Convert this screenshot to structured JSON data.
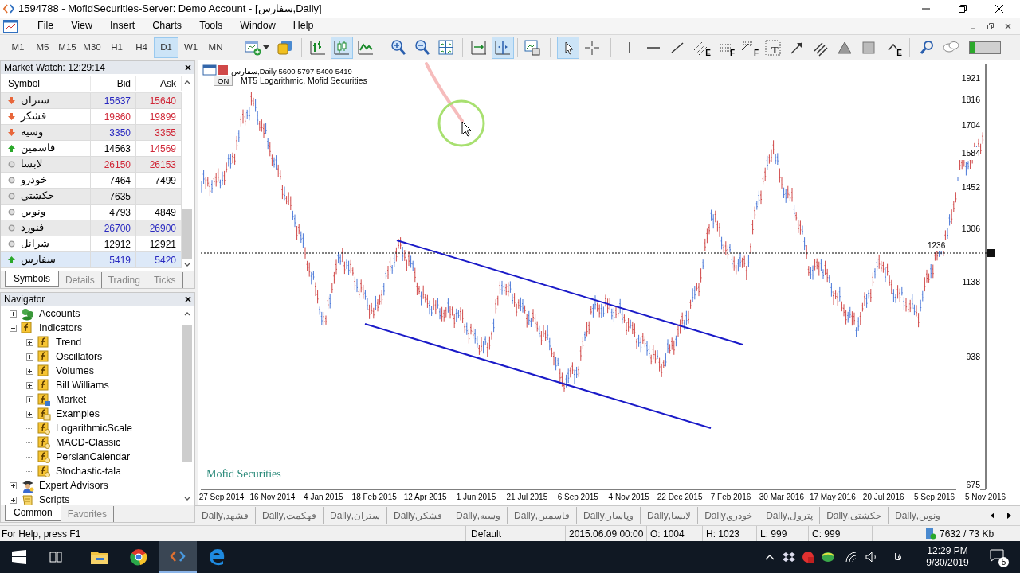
{
  "window": {
    "title": "1594788 - MofidSecurities-Server: Demo Account - [سفارس,Daily]"
  },
  "menu": [
    "File",
    "View",
    "Insert",
    "Charts",
    "Tools",
    "Window",
    "Help"
  ],
  "timeframes": [
    {
      "label": "M1",
      "selected": false
    },
    {
      "label": "M5",
      "selected": false
    },
    {
      "label": "M15",
      "selected": false
    },
    {
      "label": "M30",
      "selected": false
    },
    {
      "label": "H1",
      "selected": false
    },
    {
      "label": "H4",
      "selected": false
    },
    {
      "label": "D1",
      "selected": true
    },
    {
      "label": "W1",
      "selected": false
    },
    {
      "label": "MN",
      "selected": false
    }
  ],
  "tools": [
    {
      "kind": "new-chart",
      "selected": false
    },
    {
      "kind": "profiles",
      "selected": false
    },
    {
      "kind": "bar-chart",
      "selected": false
    },
    {
      "kind": "candle-chart",
      "selected": true
    },
    {
      "kind": "line-chart",
      "selected": false
    },
    {
      "kind": "zoom-in",
      "selected": false
    },
    {
      "kind": "zoom-out",
      "selected": false
    },
    {
      "kind": "tile",
      "selected": false
    },
    {
      "kind": "autoscroll",
      "selected": false
    },
    {
      "kind": "chart-shift",
      "selected": true
    },
    {
      "kind": "templates",
      "selected": false
    },
    {
      "kind": "cursor",
      "selected": true
    },
    {
      "kind": "crosshair",
      "selected": false
    },
    {
      "kind": "vline",
      "selected": false
    },
    {
      "kind": "hline",
      "selected": false
    },
    {
      "kind": "trendline",
      "selected": false
    },
    {
      "kind": "equidistant",
      "selected": false,
      "badge": "E"
    },
    {
      "kind": "fibo",
      "selected": false,
      "badge": "F"
    },
    {
      "kind": "fibofan",
      "selected": false,
      "badge": "F"
    },
    {
      "kind": "text",
      "selected": false,
      "badge": "T"
    },
    {
      "kind": "arrow",
      "selected": false
    },
    {
      "kind": "channel",
      "selected": false
    },
    {
      "kind": "triangle",
      "selected": false
    },
    {
      "kind": "rectangle",
      "selected": false
    },
    {
      "kind": "elliott",
      "selected": false,
      "badge": "E"
    },
    {
      "kind": "search",
      "selected": false
    },
    {
      "kind": "chat",
      "selected": false
    },
    {
      "kind": "meter",
      "selected": false
    }
  ],
  "market_watch": {
    "title": "Market Watch: 12:29:14",
    "columns": [
      "Symbol",
      "Bid",
      "Ask"
    ],
    "rows": [
      {
        "kind": "down",
        "symbol": "ستران",
        "bid": {
          "text": "15637",
          "color": "#2828c0"
        },
        "ask": {
          "text": "15640",
          "color": "#d02838"
        },
        "selected": false
      },
      {
        "kind": "down",
        "symbol": "قشکر",
        "bid": {
          "text": "19860",
          "color": "#d02838"
        },
        "ask": {
          "text": "19899",
          "color": "#d02838"
        },
        "selected": false
      },
      {
        "kind": "down",
        "symbol": "وسیه",
        "bid": {
          "text": "3350",
          "color": "#2828c0"
        },
        "ask": {
          "text": "3355",
          "color": "#d02838"
        },
        "selected": false
      },
      {
        "kind": "up",
        "symbol": "فاسمین",
        "bid": {
          "text": "14563",
          "color": "#000000"
        },
        "ask": {
          "text": "14569",
          "color": "#d02838"
        },
        "selected": false
      },
      {
        "kind": "neutral",
        "symbol": "لابسا",
        "bid": {
          "text": "26150",
          "color": "#d02838"
        },
        "ask": {
          "text": "26153",
          "color": "#d02838"
        },
        "selected": false
      },
      {
        "kind": "neutral",
        "symbol": "خودرو",
        "bid": {
          "text": "7464",
          "color": "#000000"
        },
        "ask": {
          "text": "7499",
          "color": "#000000"
        },
        "selected": false
      },
      {
        "kind": "neutral",
        "symbol": "حکشتی",
        "bid": {
          "text": "7635",
          "color": "#000000"
        },
        "selected": false
      },
      {
        "kind": "neutral",
        "symbol": "ونوین",
        "bid": {
          "text": "4793",
          "color": "#000000"
        },
        "ask": {
          "text": "4849",
          "color": "#000000"
        },
        "selected": false
      },
      {
        "kind": "neutral",
        "symbol": "فنورد",
        "bid": {
          "text": "26700",
          "color": "#2828c0"
        },
        "ask": {
          "text": "26900",
          "color": "#2828c0"
        },
        "selected": false
      },
      {
        "kind": "neutral",
        "symbol": "شرانل",
        "bid": {
          "text": "12912",
          "color": "#000000"
        },
        "ask": {
          "text": "12921",
          "color": "#000000"
        },
        "selected": false
      },
      {
        "kind": "up",
        "symbol": "سفارس",
        "bid": {
          "text": "5419",
          "color": "#2828c0"
        },
        "ask": {
          "text": "5420",
          "color": "#2828c0"
        },
        "selected": true
      }
    ],
    "tabs": [
      {
        "label": "Symbols",
        "selected": true
      },
      {
        "label": "Details",
        "selected": false
      },
      {
        "label": "Trading",
        "selected": false
      },
      {
        "label": "Ticks",
        "selected": false
      }
    ]
  },
  "navigator": {
    "title": "Navigator",
    "items": [
      {
        "label": "Accounts",
        "kind": "accounts",
        "expanded": false
      },
      {
        "label": "Indicators",
        "kind": "folder",
        "expanded": true,
        "children": [
          {
            "label": "Trend",
            "kind": "folder",
            "expanded": false
          },
          {
            "label": "Oscillators",
            "kind": "folder",
            "expanded": false
          },
          {
            "label": "Volumes",
            "kind": "folder",
            "expanded": false
          },
          {
            "label": "Bill Williams",
            "kind": "folder",
            "expanded": false
          },
          {
            "label": "Market",
            "kind": "market",
            "expanded": false
          },
          {
            "label": "Examples",
            "kind": "examples",
            "expanded": false
          },
          {
            "label": "LogarithmicScale",
            "kind": "indicator"
          },
          {
            "label": "MACD-Classic",
            "kind": "indicator"
          },
          {
            "label": "PersianCalendar",
            "kind": "indicator"
          },
          {
            "label": "Stochastic-tala",
            "kind": "indicator"
          }
        ]
      },
      {
        "label": "Expert Advisors",
        "kind": "experts",
        "expanded": false
      },
      {
        "label": "Scripts",
        "kind": "scripts",
        "expanded": false
      }
    ],
    "tabs": [
      {
        "label": "Common",
        "selected": true
      },
      {
        "label": "Favorites",
        "selected": false
      }
    ]
  },
  "chart": {
    "symbol": "سفارس,Daily",
    "quote": "5600 5797 5400 5419",
    "on_button": "ON",
    "subtitle": "MT5 Logarithmic, Mofid Securities",
    "watermark": "Mofid Securities",
    "price_labels": [
      "1921",
      "1816",
      "1704",
      "1584",
      "1452",
      "1306",
      "1138",
      "938",
      "675"
    ],
    "line_label": "1236",
    "dates": [
      "27 Sep 2014",
      "16 Nov 2014",
      "4 Jan 2015",
      "18 Feb 2015",
      "12 Apr 2015",
      "1 Jun 2015",
      "21 Jul 2015",
      "6 Sep 2015",
      "4 Nov 2015",
      "22 Dec 2015",
      "7 Feb 2016",
      "30 Mar 2016",
      "17 May 2016",
      "20 Jul 2016",
      "5 Sep 2016",
      "5 Nov 2016"
    ]
  },
  "chart_tabs": [
    "قشهد,Daily",
    "قهکمت,Daily",
    "ستران,Daily",
    "قشکر,Daily",
    "وسیه,Daily",
    "فاسمین,Daily",
    "وپاسار,Daily",
    "لابسا,Daily",
    "خودرو,Daily",
    "پترول,Daily",
    "حکشتی,Daily",
    "ونوین,Daily"
  ],
  "status_bar": {
    "help": "For Help, press F1",
    "profile": "Default",
    "time": "2015.06.09 00:00",
    "open": "O: 1004",
    "high": "H: 1023",
    "low": "L: 999",
    "close": "C: 999",
    "traffic": "7632 / 73 Kb"
  },
  "taskbar": {
    "language": "فا",
    "time": "12:29 PM",
    "date": "9/30/2019",
    "notifications": "5"
  }
}
